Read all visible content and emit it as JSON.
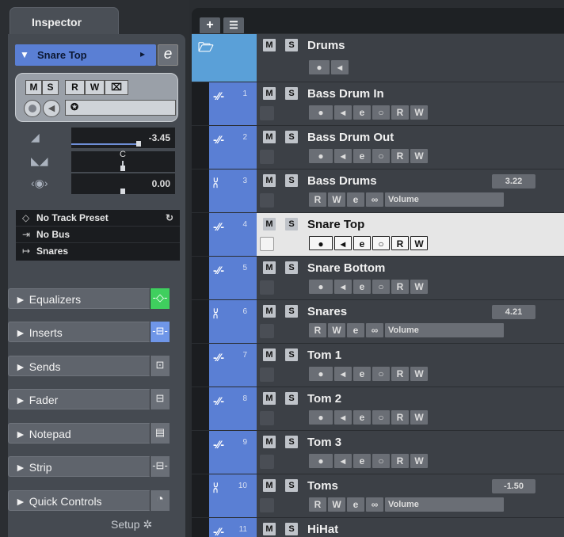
{
  "inspector": {
    "tab_label": "Inspector",
    "track_name": "Snare Top",
    "ms": [
      "M",
      "S"
    ],
    "rw": [
      "R",
      "W"
    ],
    "volume": "-3.45",
    "pan": "C",
    "delay": "0.00",
    "preset_rows": [
      {
        "icon": "preset-icon",
        "label": "No Track Preset"
      },
      {
        "icon": "bus-icon",
        "label": "No Bus"
      },
      {
        "icon": "output-icon",
        "label": "Snares"
      }
    ],
    "sections": [
      {
        "label": "Equalizers",
        "accent": "#55d26a"
      },
      {
        "label": "Inserts",
        "accent": "#6f96e8"
      },
      {
        "label": "Sends"
      },
      {
        "label": "Fader"
      },
      {
        "label": "Notepad"
      },
      {
        "label": "Strip"
      },
      {
        "label": "Quick Controls"
      }
    ],
    "setup_label": "Setup"
  },
  "tracks": [
    {
      "num": "",
      "name": "Drums",
      "type": "folder"
    },
    {
      "num": "1",
      "name": "Bass Drum In",
      "type": "audio"
    },
    {
      "num": "2",
      "name": "Bass Drum Out",
      "type": "audio"
    },
    {
      "num": "3",
      "name": "Bass Drums",
      "type": "group",
      "value": "3.22",
      "param": "Volume"
    },
    {
      "num": "4",
      "name": "Snare Top",
      "type": "audio",
      "selected": true
    },
    {
      "num": "5",
      "name": "Snare Bottom",
      "type": "audio"
    },
    {
      "num": "6",
      "name": "Snares",
      "type": "group",
      "value": "4.21",
      "param": "Volume"
    },
    {
      "num": "7",
      "name": "Tom 1",
      "type": "audio"
    },
    {
      "num": "8",
      "name": "Tom 2",
      "type": "audio"
    },
    {
      "num": "9",
      "name": "Tom 3",
      "type": "audio"
    },
    {
      "num": "10",
      "name": "Toms",
      "type": "group",
      "value": "-1.50",
      "param": "Volume"
    },
    {
      "num": "11",
      "name": "HiHat",
      "type": "audio"
    }
  ],
  "labels": {
    "m": "M",
    "s": "S",
    "r": "R",
    "w": "W"
  }
}
